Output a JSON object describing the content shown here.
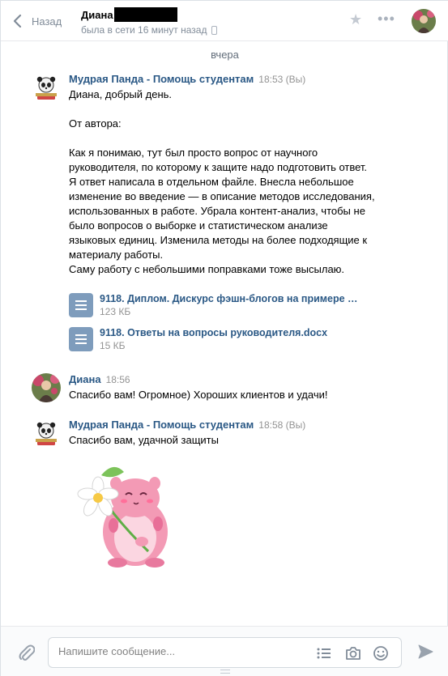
{
  "header": {
    "back_label": "Назад",
    "peer_name": "Диана",
    "peer_status": "была в сети 16 минут назад"
  },
  "date_divider": "вчера",
  "messages": [
    {
      "author": "Мудрая Панда - Помощь студентам",
      "time": "18:53 (Вы)",
      "lines": [
        "Диана, добрый день.",
        "",
        "От автора:",
        "",
        "Как я понимаю, тут был просто вопрос от научного",
        "руководителя, по которому к защите надо подготовить ответ.",
        "Я ответ написала в отдельном файле. Внесла небольшое",
        "изменение во введение — в описание методов исследования,",
        "использованных в работе. Убрала контент-анализ, чтобы не",
        "было вопросов о выборке и статистическом анализе",
        "языковых единиц. Изменила методы на более подходящие к",
        "материалу работы.",
        "Саму работу с небольшими поправками тоже высылаю."
      ],
      "attachments": [
        {
          "name": "9118. Диплом. Дискурс фэшн-блогов на примере р…",
          "size": "123 КБ"
        },
        {
          "name": "9118. Ответы на вопросы руководителя.docx",
          "size": "15 КБ"
        }
      ]
    },
    {
      "author": "Диана",
      "time": "18:56",
      "text": "Спасибо вам! Огромное) Хороших клиентов и удачи!"
    },
    {
      "author": "Мудрая Панда - Помощь студентам",
      "time": "18:58 (Вы)",
      "text": "Спасибо вам, удачной защиты"
    }
  ],
  "composer": {
    "placeholder": "Напишите сообщение..."
  },
  "icons": {
    "back": "chevron-left-icon",
    "favorite": "star-icon",
    "more": "more-horizontal-icon",
    "attach": "paperclip-icon",
    "templates": "list-icon",
    "camera": "camera-icon",
    "emoji": "smile-icon",
    "send": "send-icon",
    "sticker": "hamster-with-flower-sticker"
  },
  "colors": {
    "link": "#2a5885",
    "muted": "#818c99",
    "doc": "#7e9cbc"
  }
}
